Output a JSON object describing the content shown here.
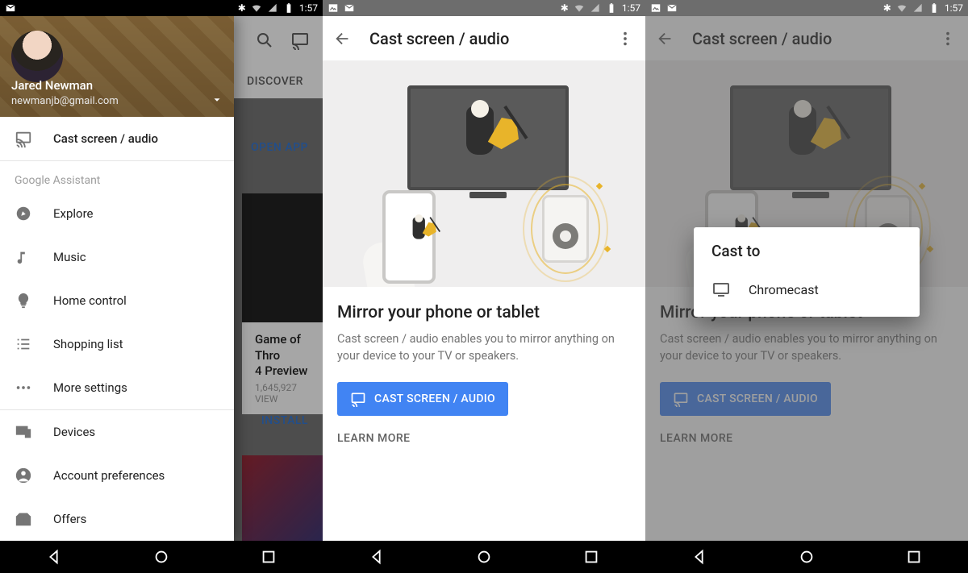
{
  "status": {
    "time": "1:57"
  },
  "panel1": {
    "bg": {
      "tab": "DISCOVER",
      "open_app": "OPEN APP",
      "card_title1": "Game of Thro",
      "card_title2": "4 Preview",
      "views": "1,645,927 VIEW",
      "install": "INSTALL"
    },
    "user": {
      "name": "Jared Newman",
      "email": "newmanjb@gmail.com"
    },
    "items": {
      "cast": "Cast screen / audio",
      "section": "Google Assistant",
      "explore": "Explore",
      "music": "Music",
      "home": "Home control",
      "shopping": "Shopping list",
      "more": "More settings",
      "devices": "Devices",
      "account": "Account preferences",
      "offers": "Offers"
    }
  },
  "castpage": {
    "title": "Cast screen / audio",
    "heading": "Mirror your phone or tablet",
    "desc": "Cast screen / audio enables you to mirror anything on your device to your TV or speakers.",
    "button": "CAST SCREEN / AUDIO",
    "learn": "LEARN MORE"
  },
  "dialog": {
    "title": "Cast to",
    "device": "Chromecast"
  }
}
